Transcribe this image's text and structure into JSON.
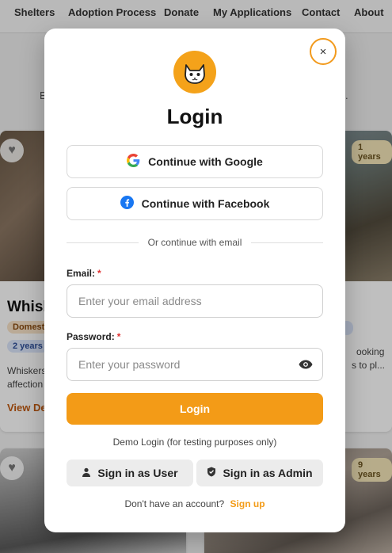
{
  "nav": {
    "items": [
      "Shelters",
      "Adoption Process",
      "Donate",
      "My Applications",
      "Contact",
      "About"
    ]
  },
  "background": {
    "hero_left_fragment": "E",
    "hero_right_fragment": ".",
    "cards": [
      {
        "title": "Whisk",
        "tags": [
          "Domest",
          "2 years"
        ],
        "desc_line1": "Whiskers",
        "desc_line2": "affection",
        "link": "View De"
      },
      {
        "age": "1 years",
        "desc_line1": "ooking",
        "desc_line2": "s to pl..."
      },
      {
        "age": "9 years"
      }
    ]
  },
  "modal": {
    "title": "Login",
    "google_label": "Continue with Google",
    "facebook_label": "Continue with Facebook",
    "divider_text": "Or continue with email",
    "email_label": "Email:",
    "email_placeholder": "Enter your email address",
    "required_mark": "*",
    "password_label": "Password:",
    "password_placeholder": "Enter your password",
    "login_label": "Login",
    "demo_note": "Demo Login (for testing purposes only)",
    "user_button_label": "Sign in as User",
    "admin_button_label": "Sign in as Admin",
    "signup_prompt": "Don't have an account?",
    "signup_link": "Sign up",
    "close_symbol": "×"
  },
  "colors": {
    "accent": "#f39b17",
    "google_blue": "#4285f4",
    "facebook_blue": "#1877f2",
    "required": "#e03131"
  },
  "icons": [
    "heart-icon",
    "cat-logo-icon",
    "close-icon",
    "google-icon",
    "facebook-icon",
    "eye-icon",
    "user-icon",
    "shield-icon"
  ]
}
